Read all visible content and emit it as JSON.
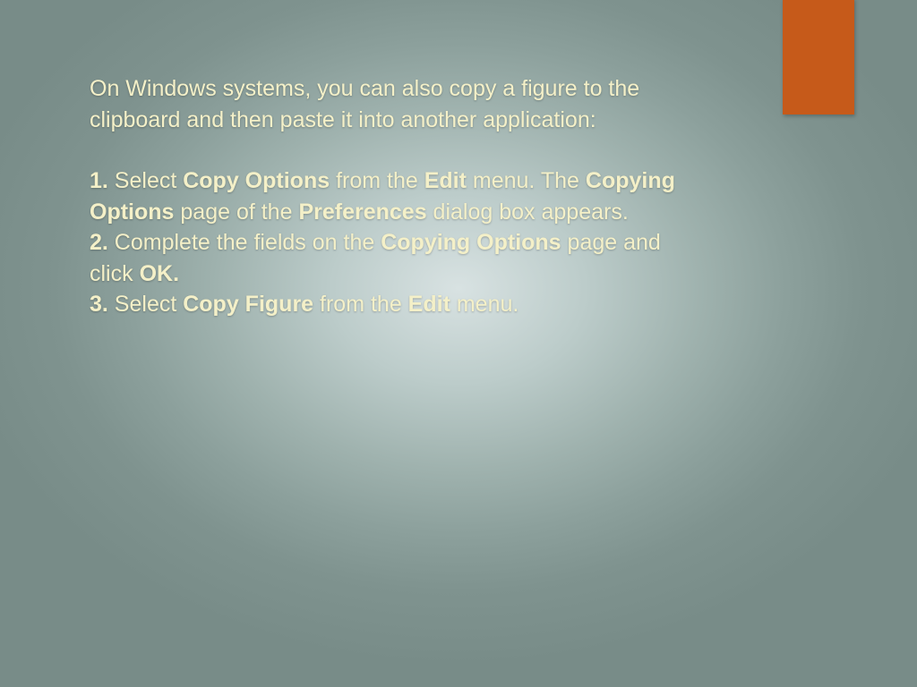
{
  "colors": {
    "accent": "#c65a1a",
    "text": "#f4f0c8"
  },
  "intro": "On Windows systems, you can also copy a figure to the clipboard and then paste it into another application:",
  "steps": [
    {
      "num": "1.",
      "parts": [
        {
          "t": "  Select ",
          "b": false
        },
        {
          "t": "Copy Options",
          "b": true
        },
        {
          "t": " from the ",
          "b": false
        },
        {
          "t": "Edit",
          "b": true
        },
        {
          "t": " menu. The ",
          "b": false
        },
        {
          "t": "Copying Options",
          "b": true
        },
        {
          "t": " page of the ",
          "b": false
        },
        {
          "t": "Preferences",
          "b": true
        },
        {
          "t": " dialog box appears.",
          "b": false
        }
      ]
    },
    {
      "num": "2.",
      "parts": [
        {
          "t": "  Complete the fields on the ",
          "b": false
        },
        {
          "t": "Copying Options",
          "b": true
        },
        {
          "t": " page and click ",
          "b": false
        },
        {
          "t": "OK.",
          "b": true
        }
      ]
    },
    {
      "num": "3.",
      "parts": [
        {
          "t": "  Select ",
          "b": false
        },
        {
          "t": "Copy Figure",
          "b": true
        },
        {
          "t": " from the ",
          "b": false
        },
        {
          "t": "Edit",
          "b": true
        },
        {
          "t": " menu.",
          "b": false
        }
      ]
    }
  ]
}
